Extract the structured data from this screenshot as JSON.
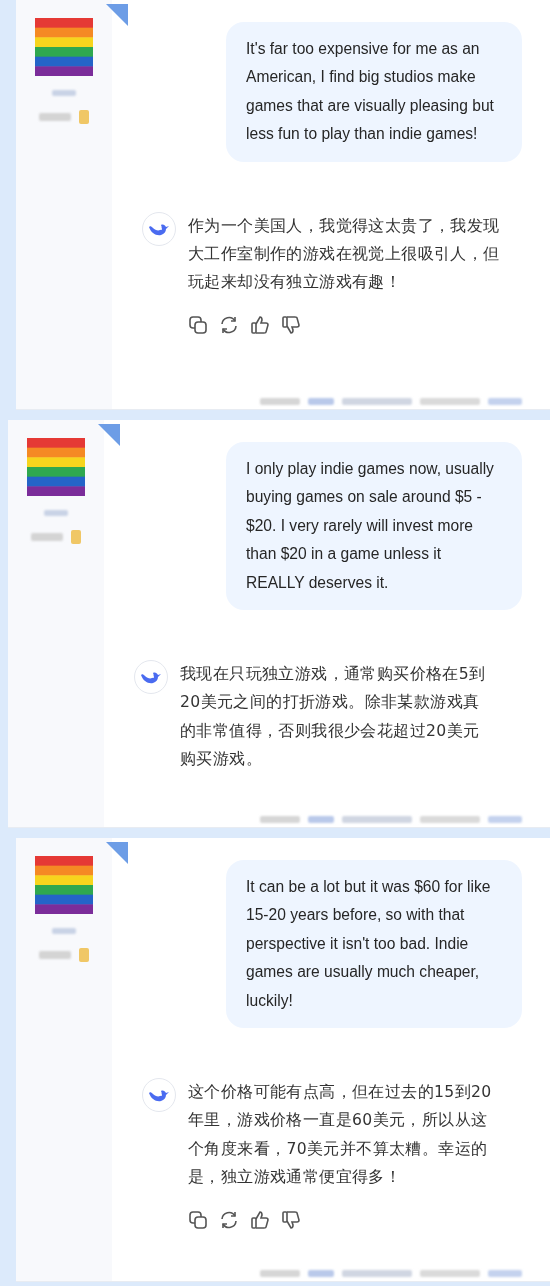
{
  "posts": [
    {
      "user_message": "It's far too expensive for me as an American, I find big studios make games that are visually pleasing but less fun to play than indie games!",
      "reply": "作为一个美国人，我觉得这太贵了，我发现大工作室制作的游戏在视觉上很吸引人，但玩起来却没有独立游戏有趣！",
      "actions": [
        {
          "kind": "copy"
        },
        {
          "kind": "regenerate"
        },
        {
          "kind": "like"
        },
        {
          "kind": "dislike"
        }
      ]
    },
    {
      "user_message": "I only play indie games now, usually buying games on sale around $5 - $20. I very rarely will invest more than $20 in a game unless it REALLY deserves it.",
      "reply": "我现在只玩独立游戏，通常购买价格在5到20美元之间的打折游戏。除非某款游戏真的非常值得，否则我很少会花超过20美元购买游戏。"
    },
    {
      "user_message": "It can be a lot but it was $60 for like 15-20 years before, so with that perspective it isn't too bad. Indie games are usually much cheaper, luckily!",
      "reply": "这个价格可能有点高，但在过去的15到20年里，游戏价格一直是60美元，所以从这个角度来看，70美元并不算太糟。幸运的是，独立游戏通常便宜得多！",
      "actions": [
        {
          "kind": "copy"
        },
        {
          "kind": "regenerate"
        },
        {
          "kind": "like"
        },
        {
          "kind": "dislike"
        }
      ]
    }
  ]
}
